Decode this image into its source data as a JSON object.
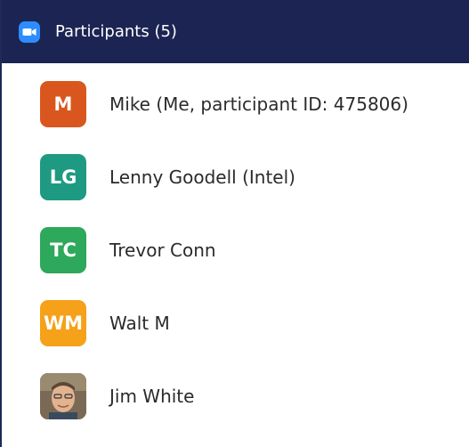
{
  "header": {
    "title": "Participants (5)",
    "icon": "zoom-camera-icon",
    "bg_color": "#1b2452",
    "icon_color": "#2d8cff"
  },
  "participants": [
    {
      "name": "Mike (Me, participant ID: 475806)",
      "initials": "M",
      "color": "#d9571e"
    },
    {
      "name": "Lenny Goodell (Intel)",
      "initials": "LG",
      "color": "#1e9a82"
    },
    {
      "name": "Trevor Conn",
      "initials": "TC",
      "color": "#2ea85a"
    },
    {
      "name": "Walt M",
      "initials": "WM",
      "color": "#f5a11a"
    },
    {
      "name": "Jim White",
      "initials": "",
      "color": "#8b6a4e",
      "avatar": "profile-photo"
    }
  ]
}
